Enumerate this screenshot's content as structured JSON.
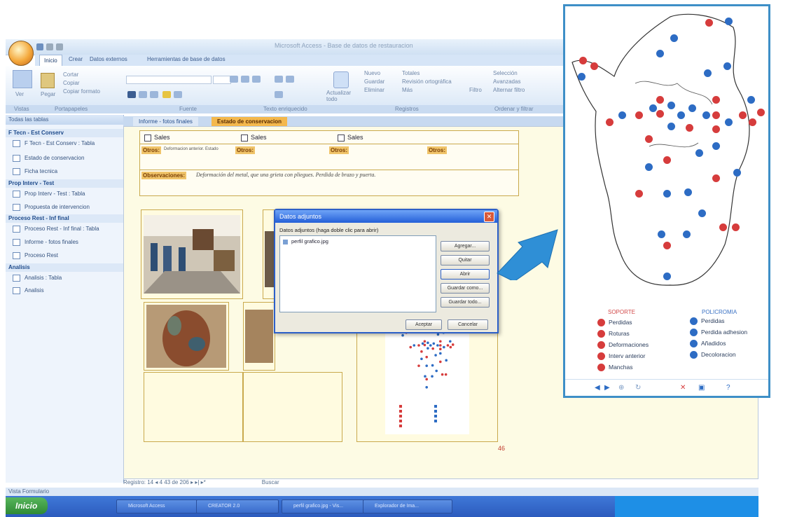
{
  "window": {
    "title": "Microsoft Access - Base de datos de restauracion",
    "ribbon_tabs": [
      "Inicio",
      "Crear",
      "Datos externos",
      "Herramientas de base de datos"
    ],
    "ribbon": {
      "ver_label": "Ver",
      "pegar_label": "Pegar",
      "cortar": "Cortar",
      "copiar": "Copiar",
      "copiar_formato": "Copiar formato",
      "actualizar_label": "Actualizar todo",
      "nuevo": "Nuevo",
      "guardar": "Guardar",
      "eliminar": "Eliminar",
      "totales": "Totales",
      "revision": "Revisión ortográfica",
      "mas": "Más",
      "filtro": "Filtro",
      "avanzadas": "Avanzadas",
      "alternar": "Alternar filtro",
      "seleccion": "Selección"
    },
    "groups": [
      "Vistas",
      "Portapapeles",
      "Fuente",
      "Texto enriquecido",
      "Registros",
      "Ordenar y filtrar"
    ]
  },
  "nav": {
    "header": "Todas las tablas",
    "sections": [
      {
        "title": "F Tecn - Est Conserv",
        "items": [
          "F Tecn - Est Conserv : Tabla",
          "Estado de conservacion",
          "Ficha tecnica"
        ]
      },
      {
        "title": "Prop Interv - Test",
        "items": [
          "Prop Interv - Test : Tabla",
          "Propuesta de intervencion"
        ]
      },
      {
        "title": "Proceso Rest - Inf final",
        "items": [
          "Proceso Rest - Inf final : Tabla",
          "Informe - fotos finales",
          "Proceso Rest"
        ]
      },
      {
        "title": "Analisis",
        "items": [
          "Analisis : Tabla",
          "Analisis"
        ]
      }
    ]
  },
  "doc_tabs": [
    "Informe - fotos finales",
    "Estado de conservacion"
  ],
  "form": {
    "sales": [
      "Sales",
      "Sales",
      "Sales"
    ],
    "otros_label": "Otros:",
    "otros_value": "Deformacion anterior. Estado",
    "observaciones_label": "Observaciones:",
    "observaciones_value": "Deformación del metal, que una grieta con pliegues. Perdida de brazo y puerta.",
    "page_number": "46",
    "records": "Registro: 14 ◂ 4 43 de 206 ▸ ▸| ▸*",
    "buscar": "Buscar"
  },
  "dialog": {
    "title": "Datos adjuntos",
    "instruction": "Datos adjuntos (haga doble clic para abrir)",
    "file": "perfil grafico.jpg",
    "buttons": [
      "Agregar...",
      "Quitar",
      "Abrir",
      "Guardar como...",
      "Guardar todo..."
    ],
    "ok": "Aceptar",
    "cancel": "Cancelar"
  },
  "panel": {
    "soporte_title": "SOPORTE",
    "policromia_title": "POLICROMIA",
    "soporte_items": [
      "Perdidas",
      "Roturas",
      "Deformaciones",
      "Interv anterior",
      "Manchas"
    ],
    "policromia_items": [
      "Perdidas",
      "Perdida adhesion",
      "Añadidos",
      "Decoloracion"
    ],
    "colors": {
      "soporte": "#d63c3c",
      "policromia": "#2d6cc4"
    }
  },
  "status": {
    "vista": "Vista Formulario"
  },
  "taskbar": {
    "start": "Inicio",
    "buttons": [
      "Microsoft Access",
      "CREATOR 2.0",
      "perfil grafico.jpg - Vis...",
      "Explorador de Ima..."
    ]
  }
}
